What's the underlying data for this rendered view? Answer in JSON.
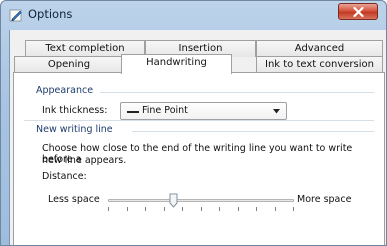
{
  "window": {
    "title": "Options"
  },
  "tabs_row1": [
    {
      "label": "Text completion"
    },
    {
      "label": "Insertion"
    },
    {
      "label": "Advanced"
    }
  ],
  "tabs_row2": [
    {
      "label": "Opening"
    },
    {
      "label": "Handwriting",
      "selected": true
    },
    {
      "label": "Ink to text conversion"
    }
  ],
  "appearance": {
    "group_label": "Appearance",
    "ink_thickness_label": "Ink thickness:",
    "ink_thickness_value": "Fine Point"
  },
  "writing_line": {
    "group_label": "New writing line",
    "description_line1": "Choose how close to the end of the writing line you want to write before a",
    "description_line2": "new line appears.",
    "distance_label": "Distance:",
    "min_label": "Less space",
    "max_label": "More space",
    "slider_position_fraction": 0.35,
    "tick_count": 11
  },
  "colors": {
    "title_gradient_top": "#bcd3ea",
    "close_button": "#c9452d",
    "group_label": "#1e3d6b"
  }
}
